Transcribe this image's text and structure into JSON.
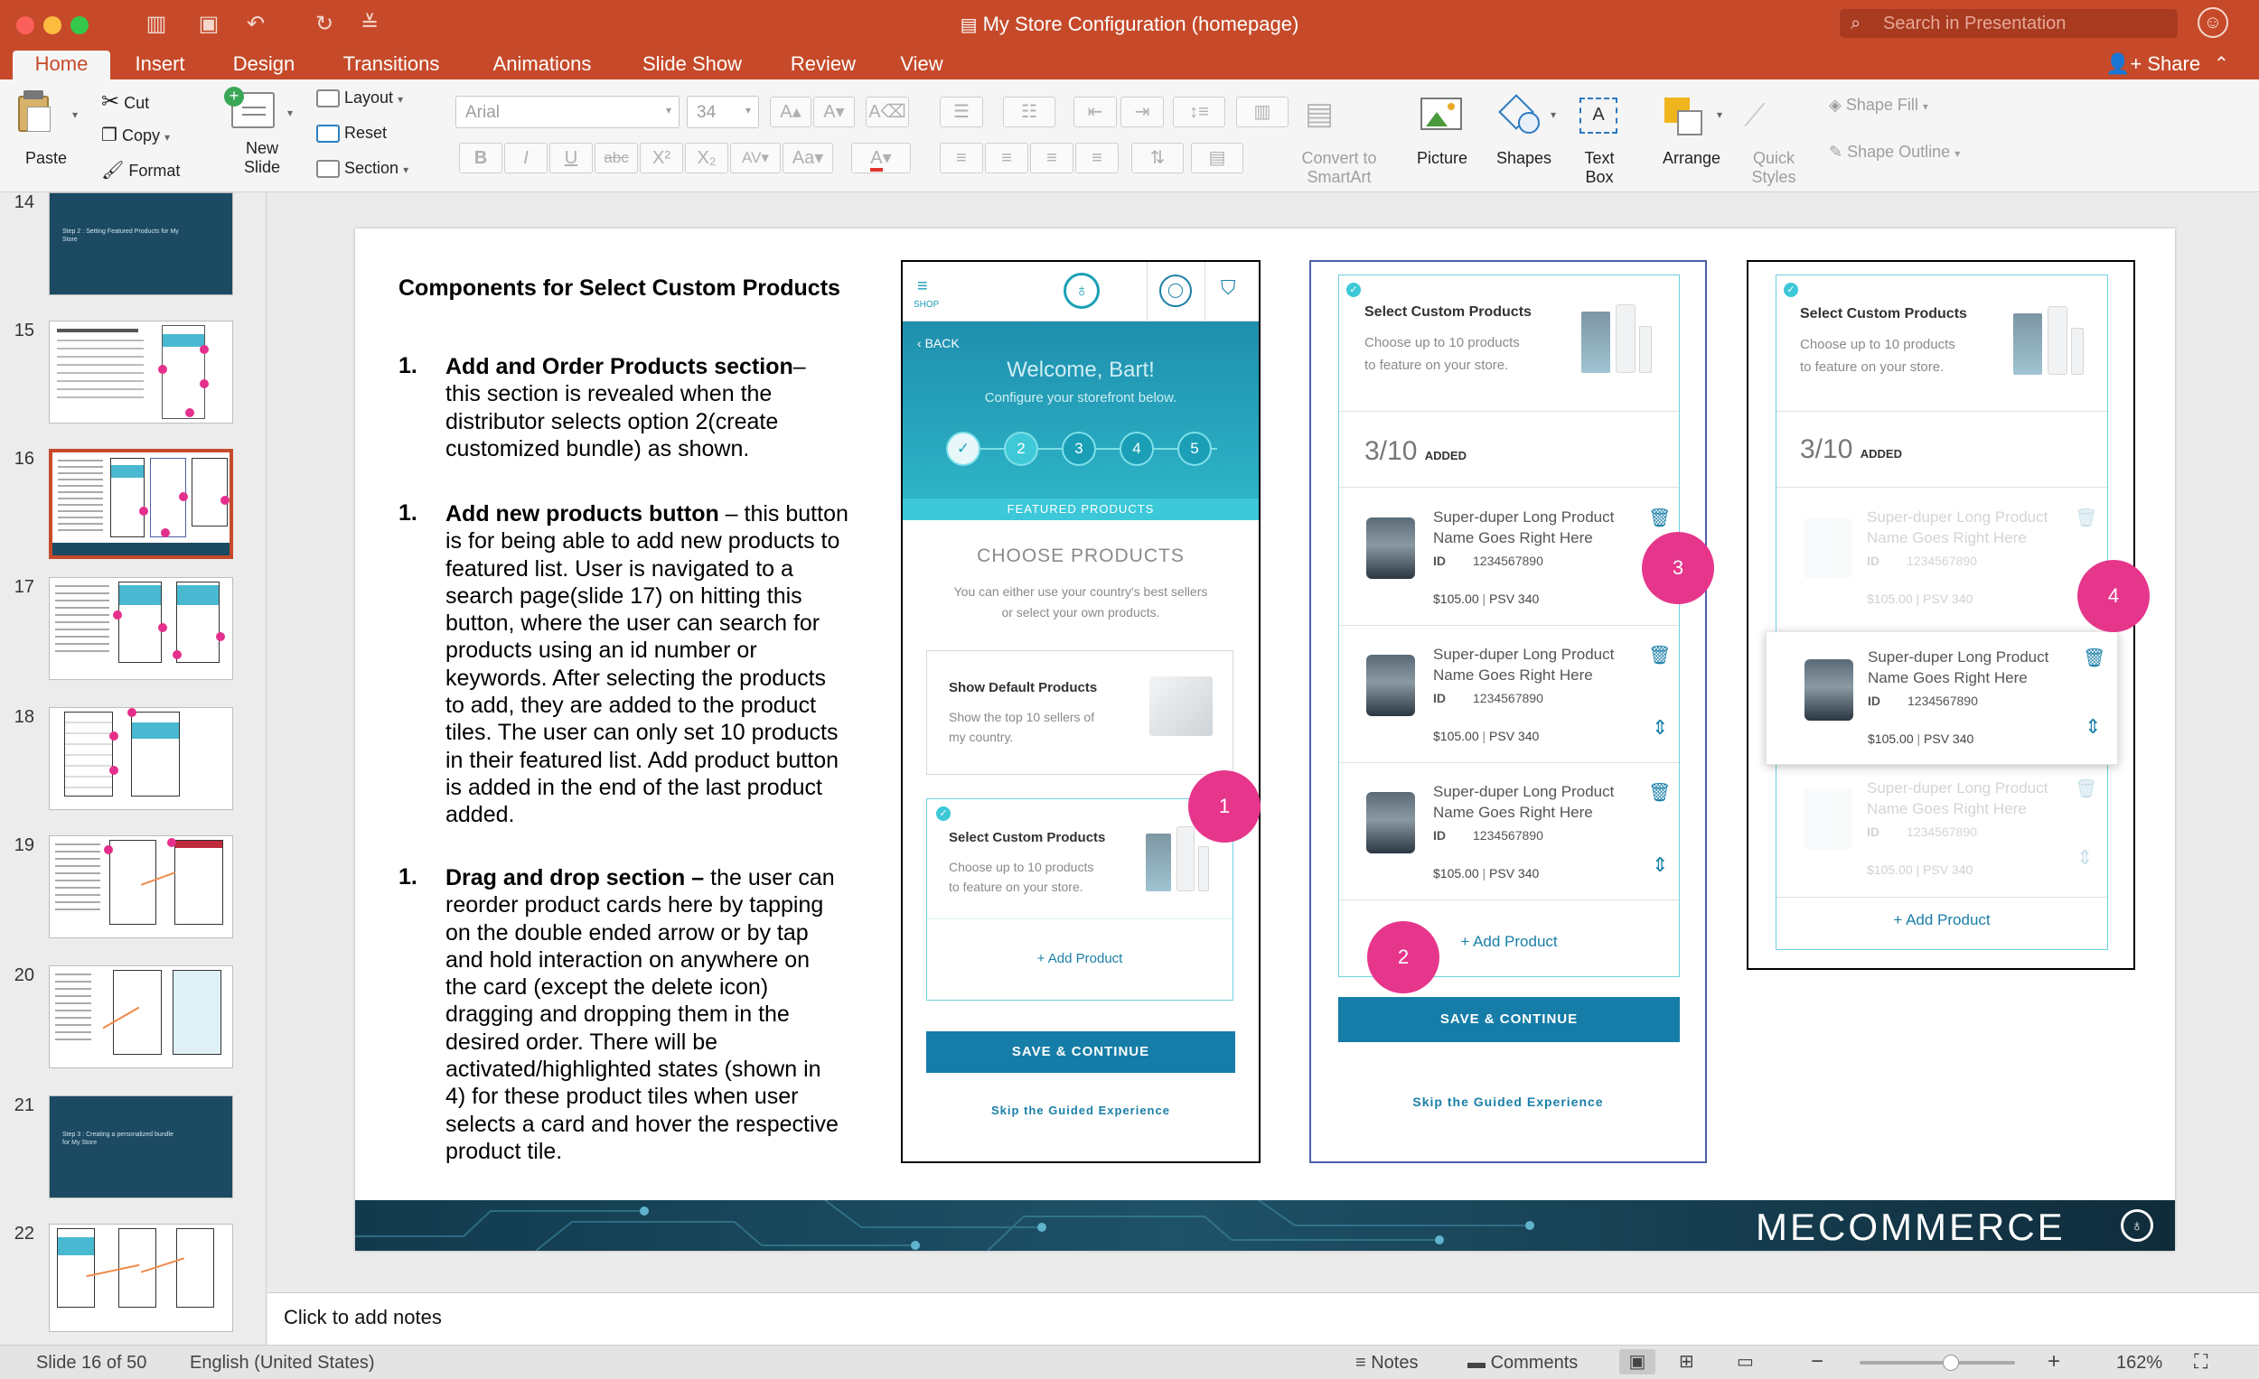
{
  "window": {
    "title": "My Store Configuration (homepage)",
    "search_placeholder": "Search in Presentation",
    "share": "Share"
  },
  "tabs": [
    "Home",
    "Insert",
    "Design",
    "Transitions",
    "Animations",
    "Slide Show",
    "Review",
    "View"
  ],
  "ribbon": {
    "paste": "Paste",
    "cut": "Cut",
    "copy": "Copy",
    "format": "Format",
    "new_slide": [
      "New",
      "Slide"
    ],
    "layout": "Layout",
    "reset": "Reset",
    "section": "Section",
    "font": "Arial",
    "size": "34",
    "convert": [
      "Convert to",
      "SmartArt"
    ],
    "picture": "Picture",
    "shapes": "Shapes",
    "textbox": [
      "Text",
      "Box"
    ],
    "arrange": "Arrange",
    "quick_styles": [
      "Quick",
      "Styles"
    ],
    "shape_fill": "Shape Fill",
    "shape_outline": "Shape Outline"
  },
  "thumbs": [
    {
      "n": "14",
      "text": "Step 2 : Setting Featured Products for My Store"
    },
    {
      "n": "15"
    },
    {
      "n": "16"
    },
    {
      "n": "17"
    },
    {
      "n": "18"
    },
    {
      "n": "19"
    },
    {
      "n": "20"
    },
    {
      "n": "21",
      "text": "Step 3 : Creating a personalized bundle for My Store"
    },
    {
      "n": "22"
    }
  ],
  "slide": {
    "title": "Components for Select Custom Products",
    "items": [
      {
        "num": "1.",
        "head": "Add and Order Products section",
        "body": [
          "– ",
          "this section is revealed when the",
          "distributor selects option 2(create",
          "customized bundle) as shown."
        ]
      },
      {
        "num": "1.",
        "head": "Add new products button",
        "body": [
          " – this button",
          "is for being able to add new products to",
          "featured list. User is navigated to a",
          "search page(slide 17) on hitting this",
          "button, where the user can search for",
          "products using an id number or",
          "keywords. After selecting the products",
          "to add, they are added to the product",
          "tiles. The user can only set 10 products",
          "in their featured list. Add product button",
          "is added in the end of the last product",
          "added."
        ]
      },
      {
        "num": "1.",
        "head": "Drag and drop section –",
        "body": [
          " the user can",
          "reorder product cards here by tapping",
          "on the double ended arrow or by tap",
          "and hold interaction on anywhere on",
          "the card (except the delete icon)",
          "dragging and dropping them in the",
          "desired order. There will be",
          "activated/highlighted states (shown in",
          "4) for these product tiles when user",
          "selects a card and hover the respective",
          "product tile."
        ]
      }
    ],
    "phone": {
      "shop": "SHOP",
      "back": "BACK",
      "welcome": "Welcome, Bart!",
      "configure": "Configure your storefront below.",
      "steps": [
        "✓",
        "2",
        "3",
        "4",
        "5"
      ],
      "featured": "FEATURED PRODUCTS",
      "choose": "CHOOSE PRODUCTS",
      "choose_desc": [
        "You can either use your country's best sellers",
        "or select your own products."
      ],
      "default_title": "Show Default Products",
      "default_desc": [
        "Show the top 10 sellers of",
        "my country."
      ],
      "custom_title": "Select Custom Products",
      "custom_desc": [
        "Choose up to 10 products",
        "to feature on your store."
      ],
      "add": "+ Add Product",
      "save": "SAVE & CONTINUE",
      "skip": "Skip the Guided Experience"
    },
    "panel": {
      "title": "Select Custom Products",
      "desc": [
        "Choose up to 10 products",
        "to feature on your store."
      ],
      "count": "3/10",
      "added": "ADDED",
      "product": [
        "Super-duper Long Product",
        "Name Goes Right Here"
      ],
      "id_label": "ID",
      "id": "1234567890",
      "price": "$105.00",
      "psv": "PSV 340",
      "add": "+ Add Product",
      "save": "SAVE & CONTINUE",
      "skip": "Skip the Guided Experience"
    },
    "badges": [
      "1",
      "2",
      "3",
      "4"
    ],
    "brand": "MECOMMERCE"
  },
  "notes": "Click to add notes",
  "status": {
    "slide": "Slide 16 of 50",
    "language": "English (United States)",
    "notes": "Notes",
    "comments": "Comments",
    "zoom": "162%"
  }
}
